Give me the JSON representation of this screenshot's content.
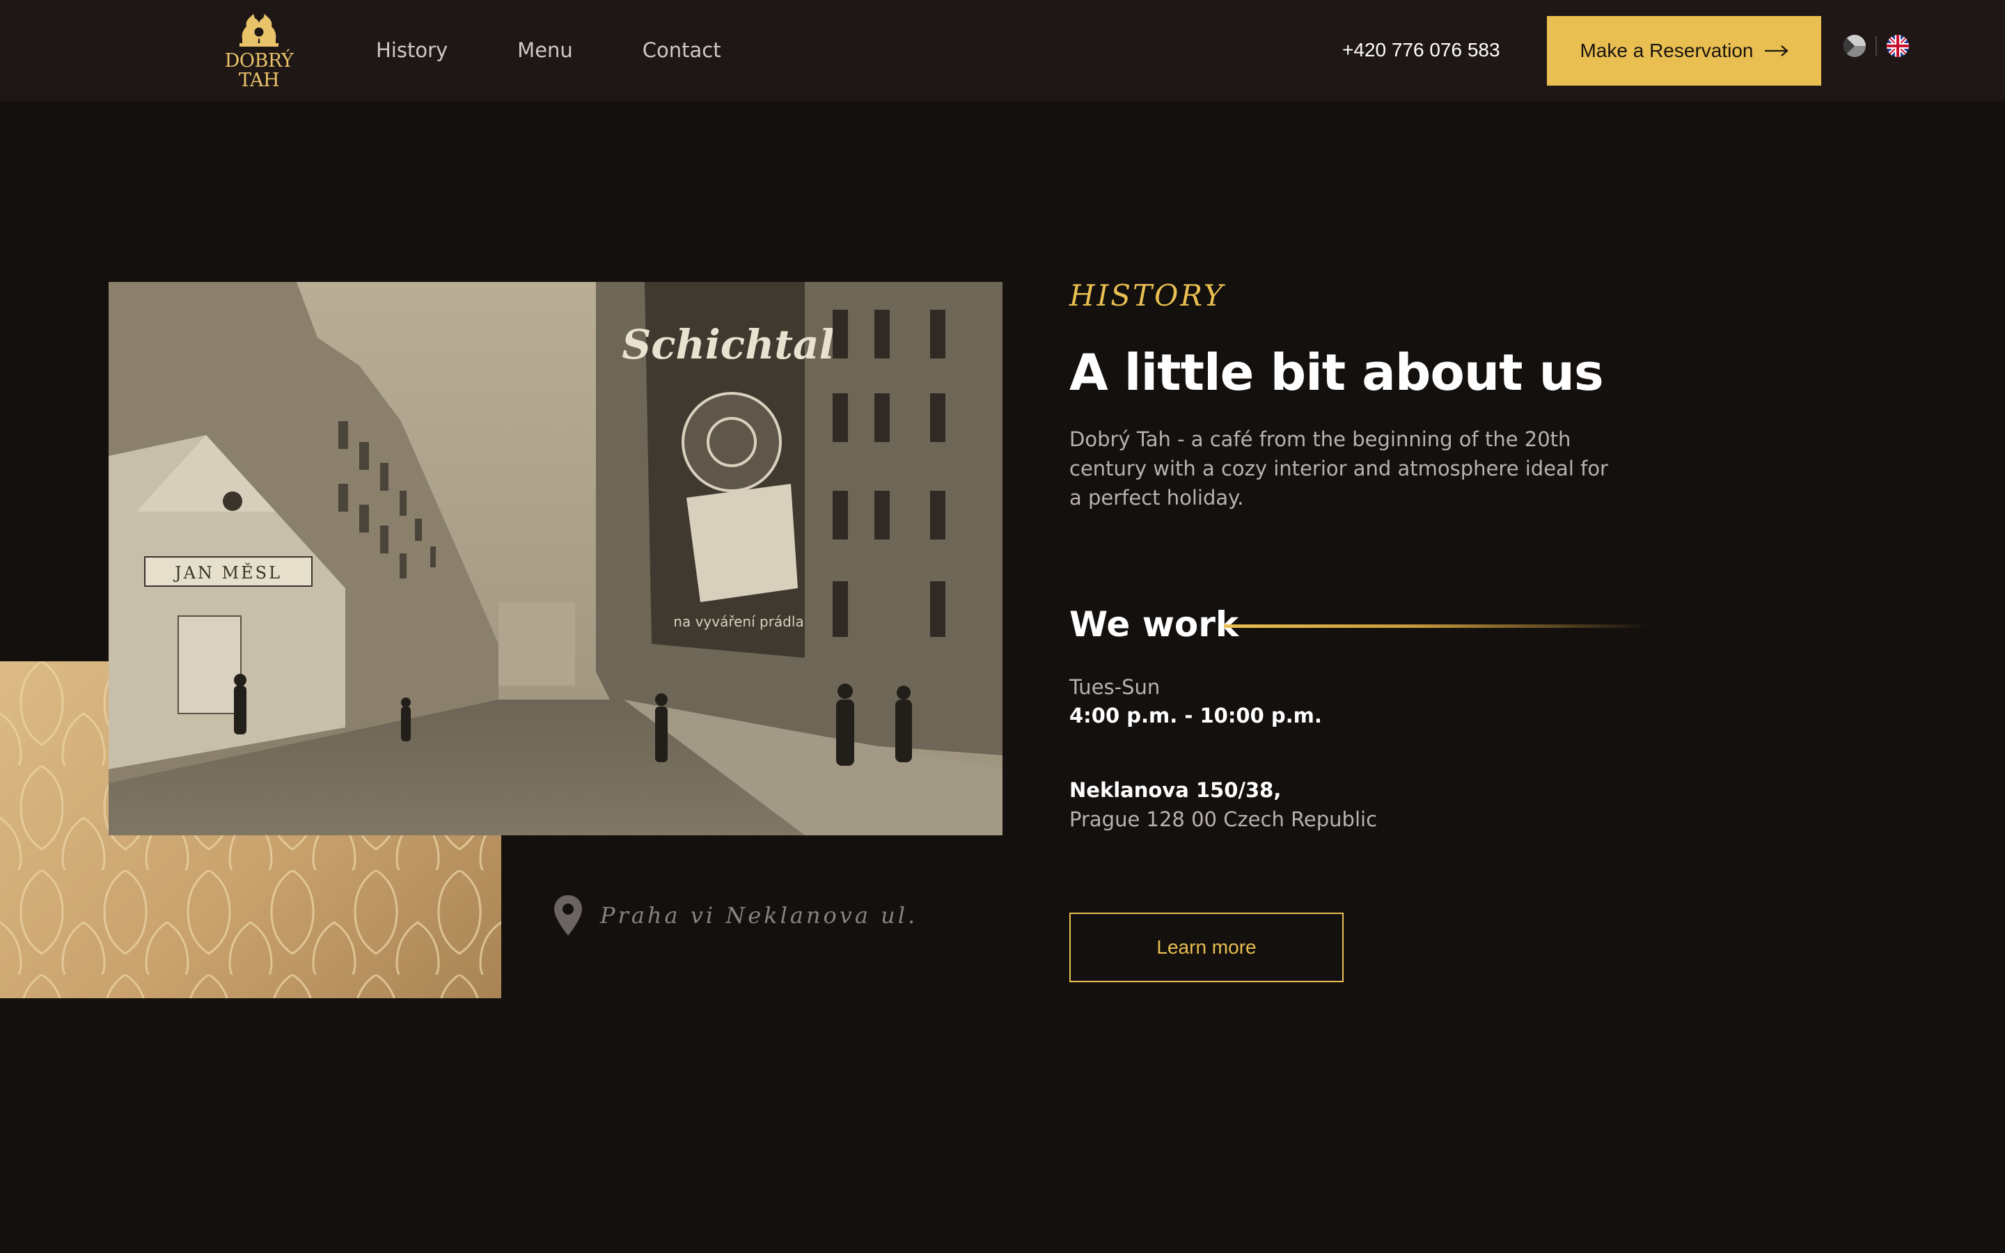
{
  "header": {
    "logo_line1": "DOBRÝ",
    "logo_line2": "TAH",
    "nav": [
      "History",
      "Menu",
      "Contact"
    ],
    "phone": "+420 776 076 583",
    "reserve_label": "Make a Reservation",
    "languages": [
      "cs",
      "en"
    ]
  },
  "history": {
    "eyebrow": "HISTORY",
    "title": "A little bit about us",
    "intro": "Dobrý Tah - a café from the beginning of the 20th century with a cozy interior and atmosphere ideal for a perfect holiday.",
    "work_title": "We work",
    "days": "Tues-Sun",
    "hours": "4:00 p.m. - 10:00 p.m.",
    "address_line1": "Neklanova 150/38,",
    "address_line2": "Prague 128 00 Czech Republic",
    "learn_more": "Learn more"
  },
  "photo": {
    "caption": "Praha vi Neklanova ul.",
    "signs": [
      "JAN MĚSL",
      "Schichtal",
      "na vyváření prádla"
    ]
  },
  "colors": {
    "accent": "#e9bf51",
    "background": "#14100e",
    "header_bg": "#1f1716",
    "muted_text": "#b9b2ae"
  }
}
